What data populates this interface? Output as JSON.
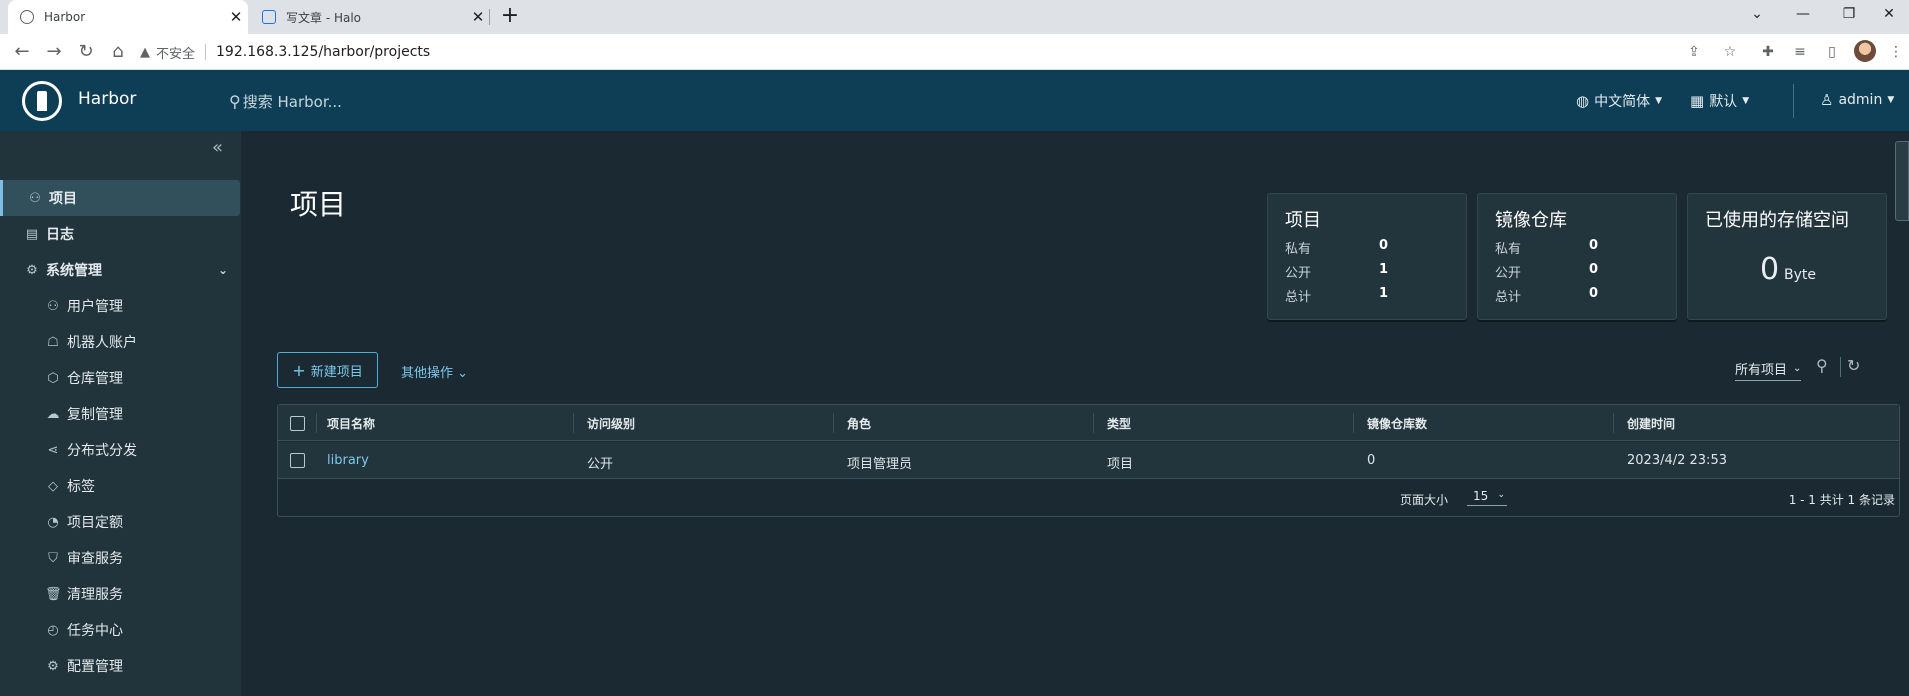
{
  "browser": {
    "tabs": [
      {
        "title": "Harbor",
        "active": true
      },
      {
        "title": "写文章 - Halo",
        "active": false
      }
    ],
    "security_label": "不安全",
    "url": "192.168.3.125/harbor/projects"
  },
  "header": {
    "brand": "Harbor",
    "search_placeholder": "搜索 Harbor...",
    "language": "中文简体",
    "date_format": "默认",
    "user": "admin"
  },
  "sidebar": {
    "items": [
      {
        "label": "项目",
        "icon": "projects-icon",
        "active": true
      },
      {
        "label": "日志",
        "icon": "logs-icon"
      },
      {
        "label": "系统管理",
        "icon": "admin-icon"
      },
      {
        "label": "用户管理",
        "icon": "users-icon"
      },
      {
        "label": "机器人账户",
        "icon": "robot-icon"
      },
      {
        "label": "仓库管理",
        "icon": "registry-icon"
      },
      {
        "label": "复制管理",
        "icon": "replication-icon"
      },
      {
        "label": "分布式分发",
        "icon": "distribution-icon"
      },
      {
        "label": "标签",
        "icon": "tag-icon"
      },
      {
        "label": "项目定额",
        "icon": "quota-icon"
      },
      {
        "label": "审查服务",
        "icon": "shield-icon"
      },
      {
        "label": "清理服务",
        "icon": "trash-icon"
      },
      {
        "label": "任务中心",
        "icon": "dashboard-icon"
      },
      {
        "label": "配置管理",
        "icon": "gear-icon"
      }
    ]
  },
  "page": {
    "title": "项目"
  },
  "cards": {
    "projects": {
      "title": "项目",
      "private_label": "私有",
      "private": "0",
      "public_label": "公开",
      "public": "1",
      "total_label": "总计",
      "total": "1"
    },
    "repos": {
      "title": "镜像仓库",
      "private_label": "私有",
      "private": "0",
      "public_label": "公开",
      "public": "0",
      "total_label": "总计",
      "total": "0"
    },
    "storage": {
      "title": "已使用的存储空间",
      "value": "0",
      "unit": "Byte"
    }
  },
  "toolbar": {
    "new_project": "新建项目",
    "other_actions": "其他操作",
    "filter": "所有项目"
  },
  "table": {
    "columns": [
      "项目名称",
      "访问级别",
      "角色",
      "类型",
      "镜像仓库数",
      "创建时间"
    ],
    "rows": [
      {
        "name": "library",
        "access": "公开",
        "role": "项目管理员",
        "type": "项目",
        "repo_count": "0",
        "created": "2023/4/2 23:53"
      }
    ],
    "page_size_label": "页面大小",
    "page_size": "15",
    "summary": "1 - 1 共计 1 条记录"
  }
}
